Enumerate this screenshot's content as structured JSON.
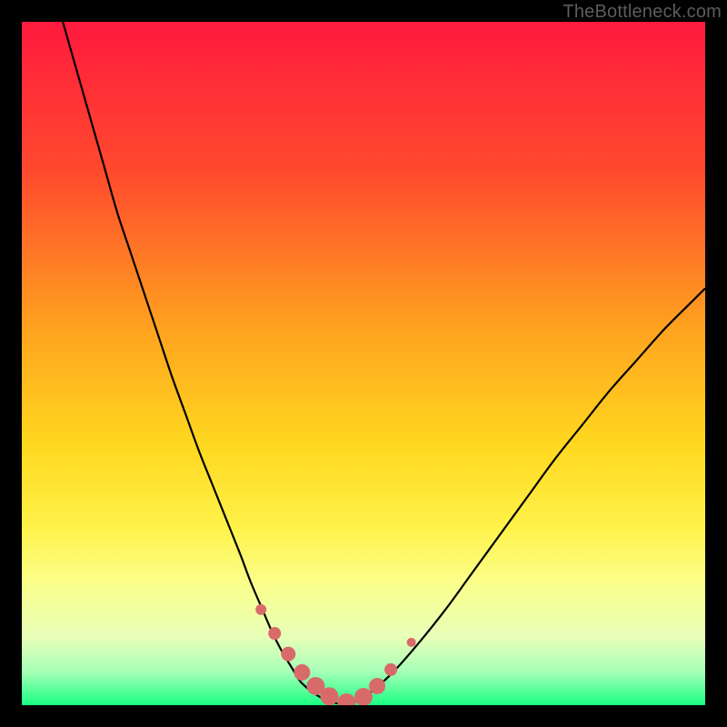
{
  "watermark": "TheBottleneck.com",
  "chart_data": {
    "type": "line",
    "title": "",
    "xlabel": "",
    "ylabel": "",
    "xlim": [
      0,
      100
    ],
    "ylim": [
      0,
      100
    ],
    "gradient_stops": [
      {
        "pos": 0.0,
        "color": "#ff1a3e"
      },
      {
        "pos": 0.22,
        "color": "#ff4a2d"
      },
      {
        "pos": 0.45,
        "color": "#ffa31f"
      },
      {
        "pos": 0.62,
        "color": "#ffd81f"
      },
      {
        "pos": 0.74,
        "color": "#fff24a"
      },
      {
        "pos": 0.82,
        "color": "#fbff8a"
      },
      {
        "pos": 0.9,
        "color": "#e8ffb8"
      },
      {
        "pos": 0.95,
        "color": "#a8ffb8"
      },
      {
        "pos": 1.0,
        "color": "#19ff83"
      }
    ],
    "series": [
      {
        "name": "bottleneck-curve",
        "stroke": "#000000",
        "stroke_width": 2.2,
        "x": [
          6,
          8,
          10,
          12,
          14,
          16,
          18,
          20,
          22,
          24,
          26,
          28,
          30,
          32,
          33.5,
          35,
          36.5,
          38,
          39.5,
          41,
          44,
          47,
          50,
          54,
          58,
          62,
          66,
          70,
          74,
          78,
          82,
          86,
          90,
          94,
          98,
          100
        ],
        "y": [
          100,
          93,
          86,
          79,
          72,
          66,
          60,
          54,
          48,
          42.5,
          37,
          32,
          27,
          22,
          18,
          14.5,
          11,
          8,
          5.5,
          3.2,
          1.0,
          0.2,
          1.2,
          4.5,
          9,
          14,
          19.5,
          25,
          30.5,
          36,
          41,
          46,
          50.5,
          55,
          59,
          61
        ]
      }
    ],
    "markers": {
      "name": "highlight-dots",
      "color": "#d96a6a",
      "points": [
        {
          "x": 35.0,
          "y": 14.0,
          "r": 6
        },
        {
          "x": 37.0,
          "y": 10.5,
          "r": 7
        },
        {
          "x": 39.0,
          "y": 7.5,
          "r": 8
        },
        {
          "x": 41.0,
          "y": 4.8,
          "r": 9
        },
        {
          "x": 43.0,
          "y": 2.8,
          "r": 10
        },
        {
          "x": 45.0,
          "y": 1.3,
          "r": 10
        },
        {
          "x": 47.5,
          "y": 0.4,
          "r": 10
        },
        {
          "x": 50.0,
          "y": 1.2,
          "r": 10
        },
        {
          "x": 52.0,
          "y": 2.8,
          "r": 9
        },
        {
          "x": 54.0,
          "y": 5.2,
          "r": 7
        },
        {
          "x": 57.0,
          "y": 9.2,
          "r": 5
        }
      ]
    }
  }
}
